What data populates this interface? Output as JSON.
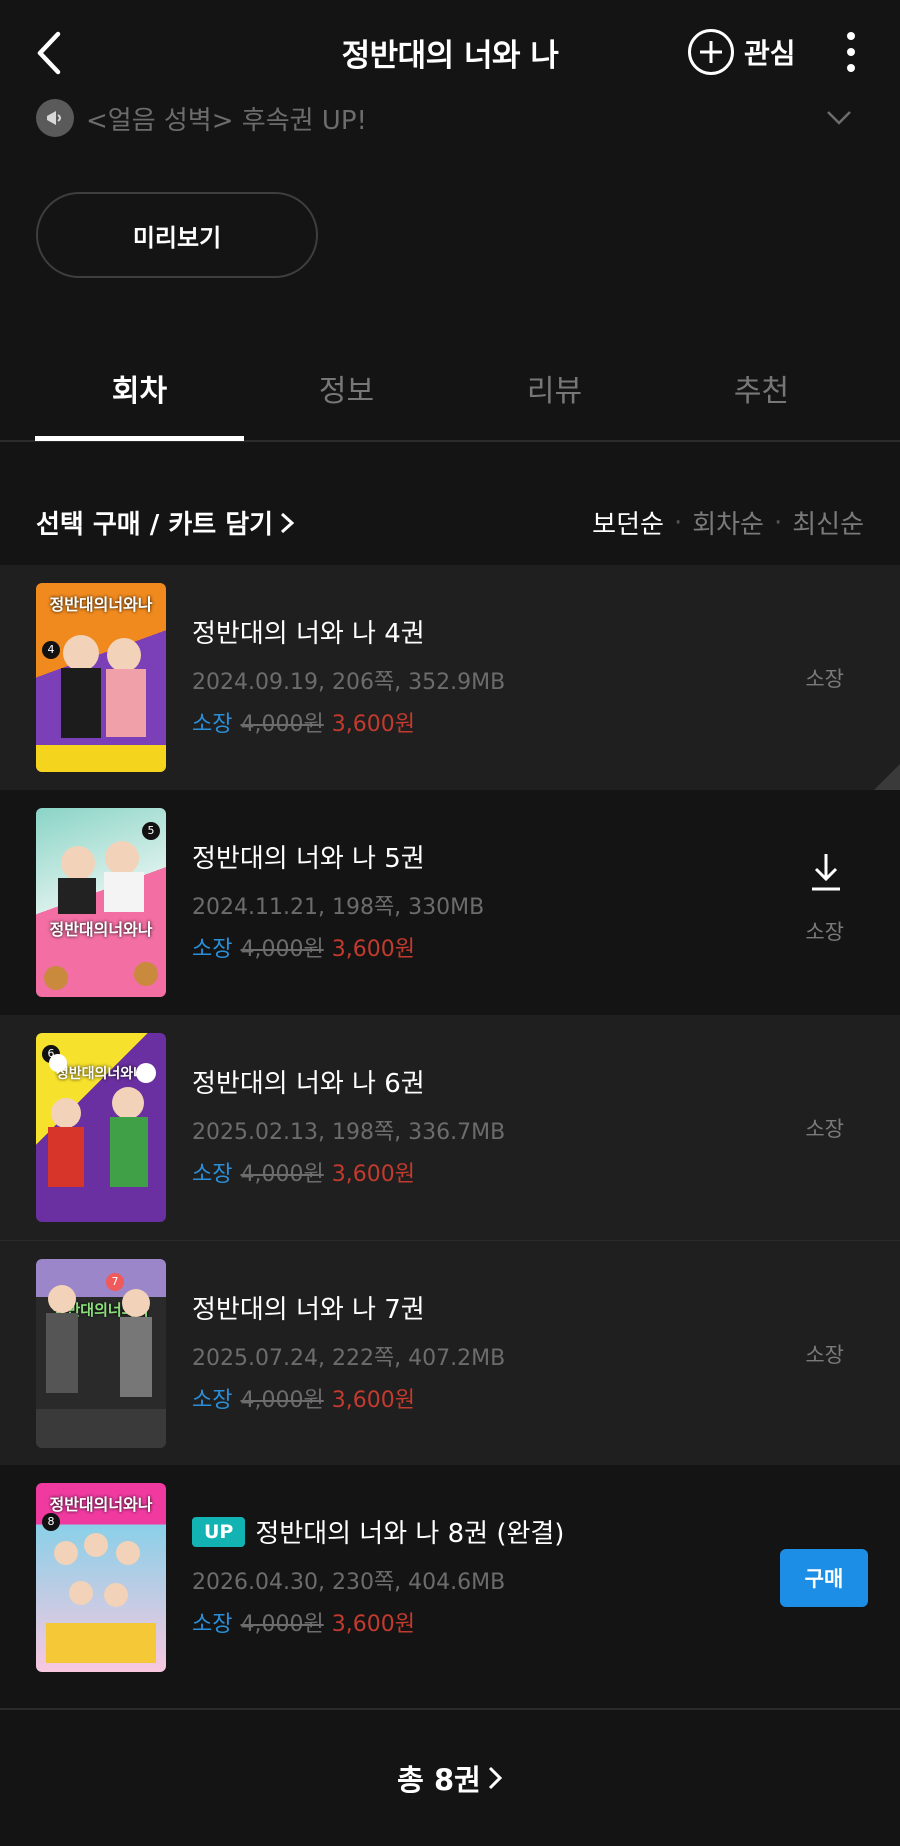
{
  "header": {
    "title": "정반대의 너와 나",
    "favorite_label": "관심"
  },
  "notice": {
    "text": "<얼음 성벽> 후속권 UP!"
  },
  "preview_label": "미리보기",
  "tabs": [
    {
      "label": "회차"
    },
    {
      "label": "정보"
    },
    {
      "label": "리뷰"
    },
    {
      "label": "추천"
    }
  ],
  "toolbar": {
    "select_buy_label": "선택 구매 / 카트 담기",
    "sort_options": [
      "보던순",
      "회차순",
      "최신순"
    ],
    "active_sort": "보던순"
  },
  "episodes": [
    {
      "title": "정반대의 너와 나 4권",
      "meta": "2024.09.19, 206쪽, 352.9MB",
      "own_label": "소장",
      "original_price": "4,000원",
      "sale_price": "3,600원",
      "state": "소장",
      "cover_title": "정반대의너와나",
      "cover_number": "4",
      "cover_colors": [
        "#f08a1e",
        "#7b3fb8"
      ]
    },
    {
      "title": "정반대의 너와 나 5권",
      "meta": "2024.11.21, 198쪽, 330MB",
      "own_label": "소장",
      "original_price": "4,000원",
      "sale_price": "3,600원",
      "state": "소장",
      "cover_title": "정반대의너와나",
      "cover_number": "5",
      "cover_colors": [
        "#8ad4c6",
        "#f26ea3"
      ]
    },
    {
      "title": "정반대의 너와 나 6권",
      "meta": "2025.02.13, 198쪽, 336.7MB",
      "own_label": "소장",
      "original_price": "4,000원",
      "sale_price": "3,600원",
      "state": "소장",
      "cover_title": "정반대의너와나",
      "cover_number": "6",
      "cover_colors": [
        "#f6e12c",
        "#6a2fa0"
      ]
    },
    {
      "title": "정반대의 너와 나 7권",
      "meta": "2025.07.24, 222쪽, 407.2MB",
      "own_label": "소장",
      "original_price": "4,000원",
      "sale_price": "3,600원",
      "state": "소장",
      "cover_title": "정반대의너와나",
      "cover_number": "7",
      "cover_colors": [
        "#9a86c8",
        "#3a3a3a"
      ]
    },
    {
      "title": "정반대의 너와 나 8권 (완결)",
      "up_badge": "UP",
      "meta": "2026.04.30, 230쪽, 404.6MB",
      "own_label": "소장",
      "original_price": "4,000원",
      "sale_price": "3,600원",
      "buy_label": "구매",
      "cover_title": "정반대의너와나",
      "cover_number": "8",
      "cover_colors": [
        "#f03aa0",
        "#8ad0e8"
      ]
    }
  ],
  "footer": {
    "total_label": "총 8권"
  },
  "colors": {
    "background": "#141414",
    "row_light": "#1f1f1f",
    "own_label": "#2a8fd8",
    "sale_price": "#c23b2e",
    "up_badge": "#14b3b3",
    "buy_button": "#1d8ee6"
  },
  "icons": [
    "back-arrow-icon",
    "plus-circle-icon",
    "more-vertical-icon",
    "megaphone-icon",
    "chevron-down-icon",
    "chevron-right-icon",
    "download-icon"
  ]
}
